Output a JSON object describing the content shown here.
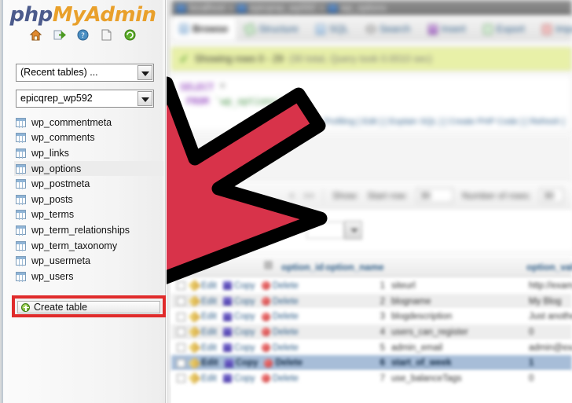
{
  "app": {
    "logo_php": "php",
    "logo_my": "My",
    "logo_admin": "Admin"
  },
  "sidebar": {
    "icons": [
      {
        "name": "home-icon",
        "label": "Home"
      },
      {
        "name": "logout-icon",
        "label": "Log out"
      },
      {
        "name": "docs-icon",
        "label": "phpMyAdmin documentation"
      },
      {
        "name": "sql-docs-icon",
        "label": "Documentation"
      },
      {
        "name": "reload-icon",
        "label": "Reload navigation"
      }
    ],
    "recent_tables_select": {
      "value": "(Recent tables) ...",
      "options": [
        "(Recent tables) ..."
      ]
    },
    "database_select": {
      "value": "epicqrep_wp592",
      "options": [
        "epicqrep_wp592"
      ]
    },
    "tables": [
      {
        "name": "wp_commentmeta",
        "selected": false
      },
      {
        "name": "wp_comments",
        "selected": false
      },
      {
        "name": "wp_links",
        "selected": false
      },
      {
        "name": "wp_options",
        "selected": true
      },
      {
        "name": "wp_postmeta",
        "selected": false
      },
      {
        "name": "wp_posts",
        "selected": false
      },
      {
        "name": "wp_terms",
        "selected": false
      },
      {
        "name": "wp_term_relationships",
        "selected": false
      },
      {
        "name": "wp_term_taxonomy",
        "selected": false
      },
      {
        "name": "wp_usermeta",
        "selected": false
      },
      {
        "name": "wp_users",
        "selected": false
      }
    ],
    "create_table_label": "Create table"
  },
  "breadcrumb": {
    "server": "localhost",
    "database": "epicqrep_wp592",
    "table": "wp_options",
    "separator": "»"
  },
  "tabs": [
    {
      "label": "Browse",
      "icon": "browse-icon",
      "active": true
    },
    {
      "label": "Structure",
      "icon": "structure-icon",
      "active": false
    },
    {
      "label": "SQL",
      "icon": "sql-icon",
      "active": false
    },
    {
      "label": "Search",
      "icon": "search-icon",
      "active": false
    },
    {
      "label": "Insert",
      "icon": "insert-icon",
      "active": false
    },
    {
      "label": "Export",
      "icon": "export-icon",
      "active": false
    },
    {
      "label": "Import",
      "icon": "import-icon",
      "active": false
    }
  ],
  "status": {
    "text": "Showing rows 0 - 29",
    "detail": "(30 total, Query took 0.0010 sec)"
  },
  "sql": {
    "keyword_select": "SELECT",
    "star": "*",
    "keyword_from": "FROM",
    "table": "`wp_options`",
    "links": "Profiling [ Edit ] [ Explain SQL ] [ Create PHP Code ] [ Refresh ]"
  },
  "pager": {
    "prev": "<",
    "next": ">>",
    "show_label": "Show:",
    "start_row_label": "Start row:",
    "start_row_value": "30",
    "number_of_rows_label": "Number of rows:",
    "number_of_rows_value": "30"
  },
  "filter": {
    "value": "",
    "placeholder": ""
  },
  "results": {
    "columns": [
      "option_id",
      "option_name",
      "option_value"
    ],
    "sort_arrow": "▲",
    "actions": {
      "edit": "Edit",
      "copy": "Copy",
      "delete": "Delete"
    },
    "rows": [
      {
        "id": "1",
        "name": "siteurl",
        "value": "http://example",
        "state": "odd"
      },
      {
        "id": "2",
        "name": "blogname",
        "value": "My Blog",
        "state": "even"
      },
      {
        "id": "3",
        "name": "blogdescription",
        "value": "Just another",
        "state": "odd"
      },
      {
        "id": "4",
        "name": "users_can_register",
        "value": "0",
        "state": "even"
      },
      {
        "id": "5",
        "name": "admin_email",
        "value": "admin@exa",
        "state": "odd"
      },
      {
        "id": "6",
        "name": "start_of_week",
        "value": "1",
        "state": "sel"
      },
      {
        "id": "7",
        "name": "use_balanceTags",
        "value": "0",
        "state": "odd"
      }
    ]
  },
  "annotation": {
    "arrow_name": "pointer-arrow",
    "arrow_fill": "#d8334a",
    "arrow_stroke": "#000000",
    "highlight_color": "#e02b2b",
    "points_at": "Create table"
  }
}
